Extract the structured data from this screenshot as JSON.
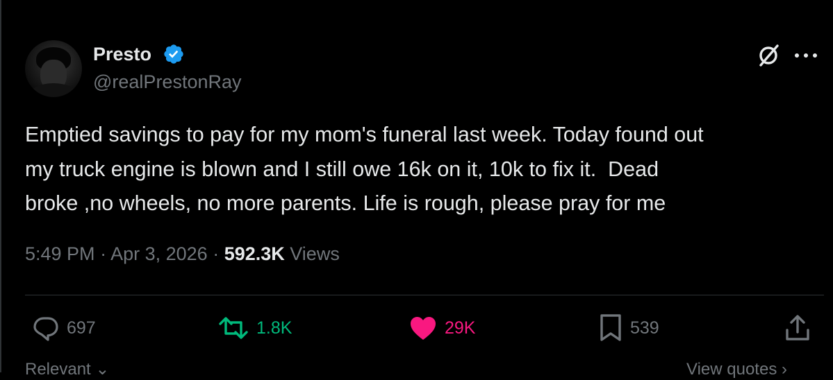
{
  "author": {
    "display_name": "Presto",
    "handle": "@realPrestonRay",
    "verified_icon": "verified-badge-icon"
  },
  "header_icons": [
    "grok-icon",
    "more-options-icon"
  ],
  "tweet": {
    "text": "Emptied savings to pay for my mom's funeral last week. Today found out\nmy truck engine is blown and I still owe 16k on it, 10k to fix it.  Dead\nbroke ,no wheels, no more parents. Life is rough, please pray for me"
  },
  "meta": {
    "time": "5:49 PM",
    "separator": " · ",
    "date": "Apr 3, 2026",
    "views_count": "592.3K",
    "views_label": "Views"
  },
  "actions": {
    "replies": "697",
    "reposts": "1.8K",
    "likes": "29K",
    "bookmarks": "539"
  },
  "footer": {
    "sort_label": "Relevant",
    "quotes_link": "View quotes"
  },
  "colors": {
    "background": "#000000",
    "text": "#e7e9ea",
    "muted": "#71767b",
    "verified": "#1d9bf0",
    "repost": "#00ba7c",
    "like": "#f91880"
  }
}
